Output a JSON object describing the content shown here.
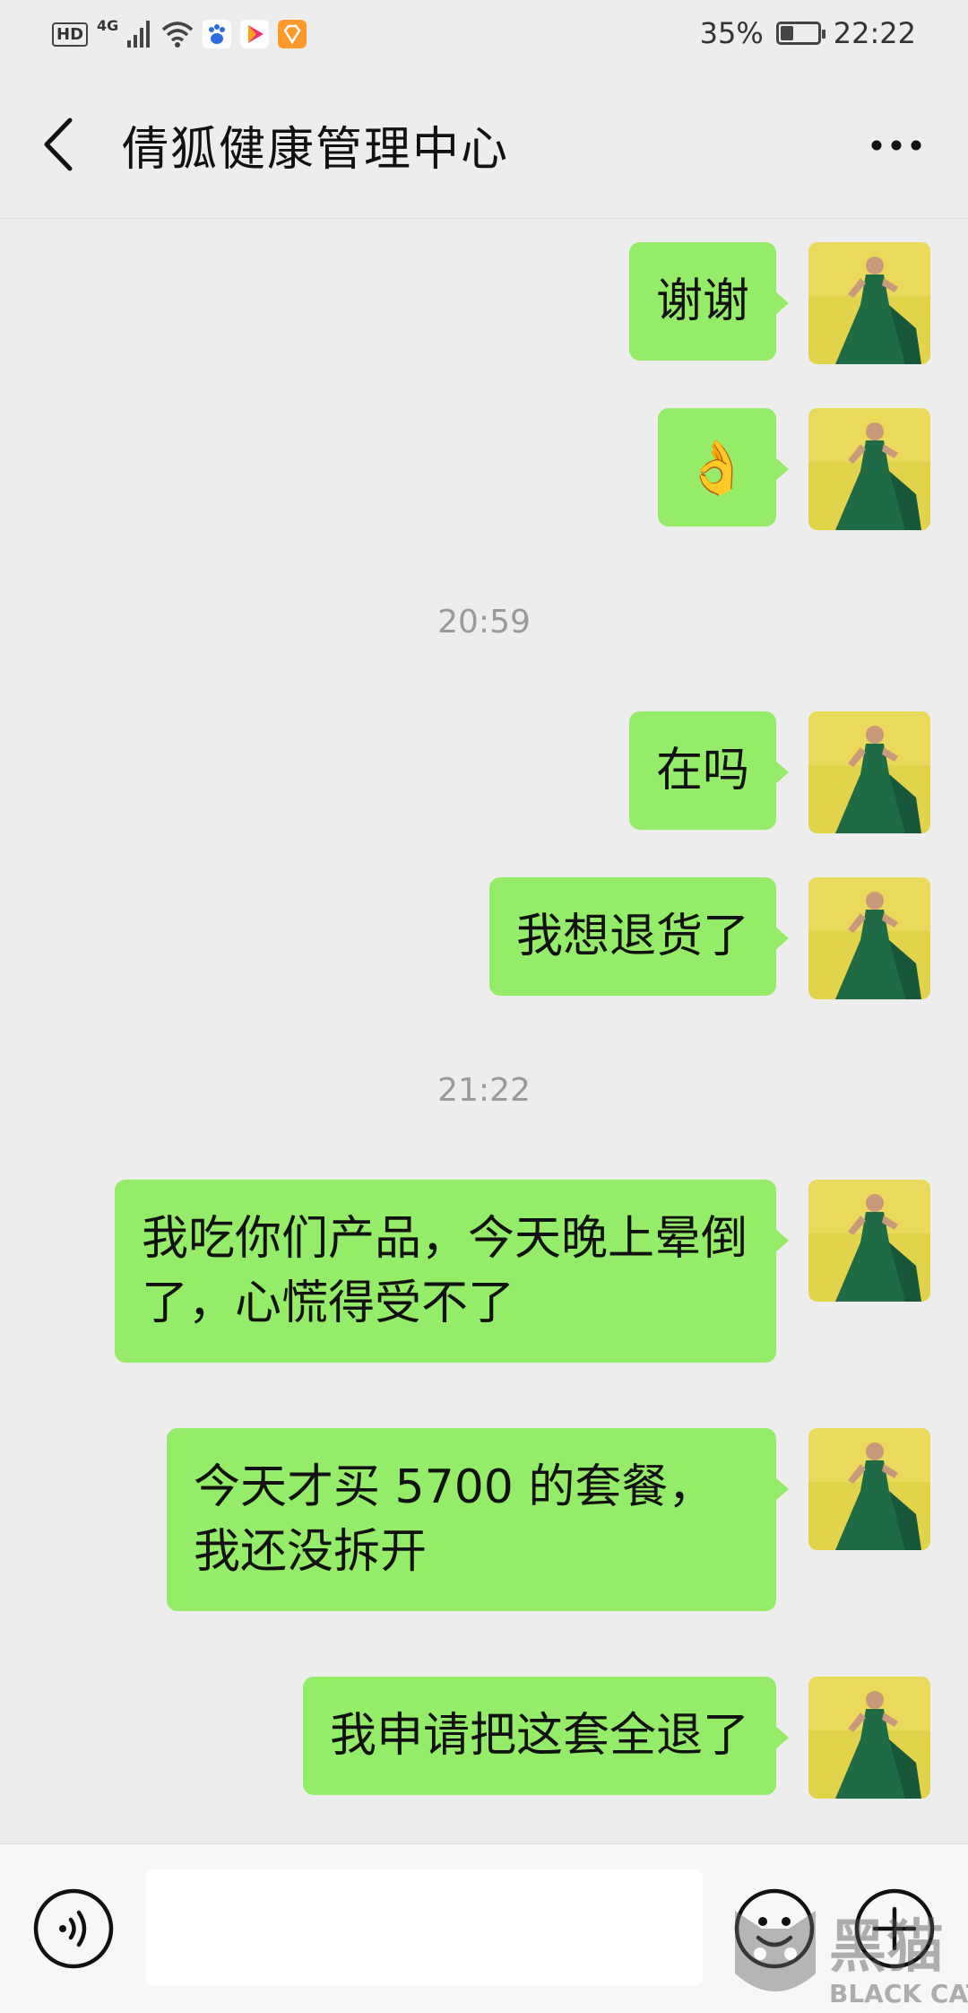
{
  "status_bar": {
    "hd": "HD",
    "network": "4G",
    "battery_text": "35%",
    "battery_level": 0.35,
    "time": "22:22",
    "icons": [
      "hd-icon",
      "signal-icon",
      "wifi-icon",
      "baidu-app-icon",
      "video-app-icon",
      "diamond-app-icon",
      "battery-icon"
    ]
  },
  "header": {
    "title": "倩狐健康管理中心",
    "back_icon": "chevron-left-icon",
    "more_icon": "more-dots-icon"
  },
  "messages": [
    {
      "sender": "me",
      "text": "谢谢"
    },
    {
      "sender": "me",
      "text": "👌"
    },
    {
      "type": "timestamp",
      "text": "20:59"
    },
    {
      "sender": "me",
      "text": "在吗"
    },
    {
      "sender": "me",
      "text": "我想退货了"
    },
    {
      "type": "timestamp",
      "text": "21:22"
    },
    {
      "sender": "me",
      "text": "我吃你们产品，今天晚上晕倒了，心慌得受不了"
    },
    {
      "sender": "me",
      "text": "今天才买 5700 的套餐，我还没拆开"
    },
    {
      "sender": "me",
      "text": "我申请把这套全退了"
    }
  ],
  "input_bar": {
    "placeholder": "",
    "voice_icon": "voice-icon",
    "emoji_icon": "emoji-icon",
    "plus_icon": "plus-icon"
  },
  "watermark": {
    "text_cn": "黑猫",
    "text_en": "BLACK CAT"
  },
  "colors": {
    "background": "#ededed",
    "bubble": "#95ec69",
    "timestamp": "#9a9a9a"
  }
}
